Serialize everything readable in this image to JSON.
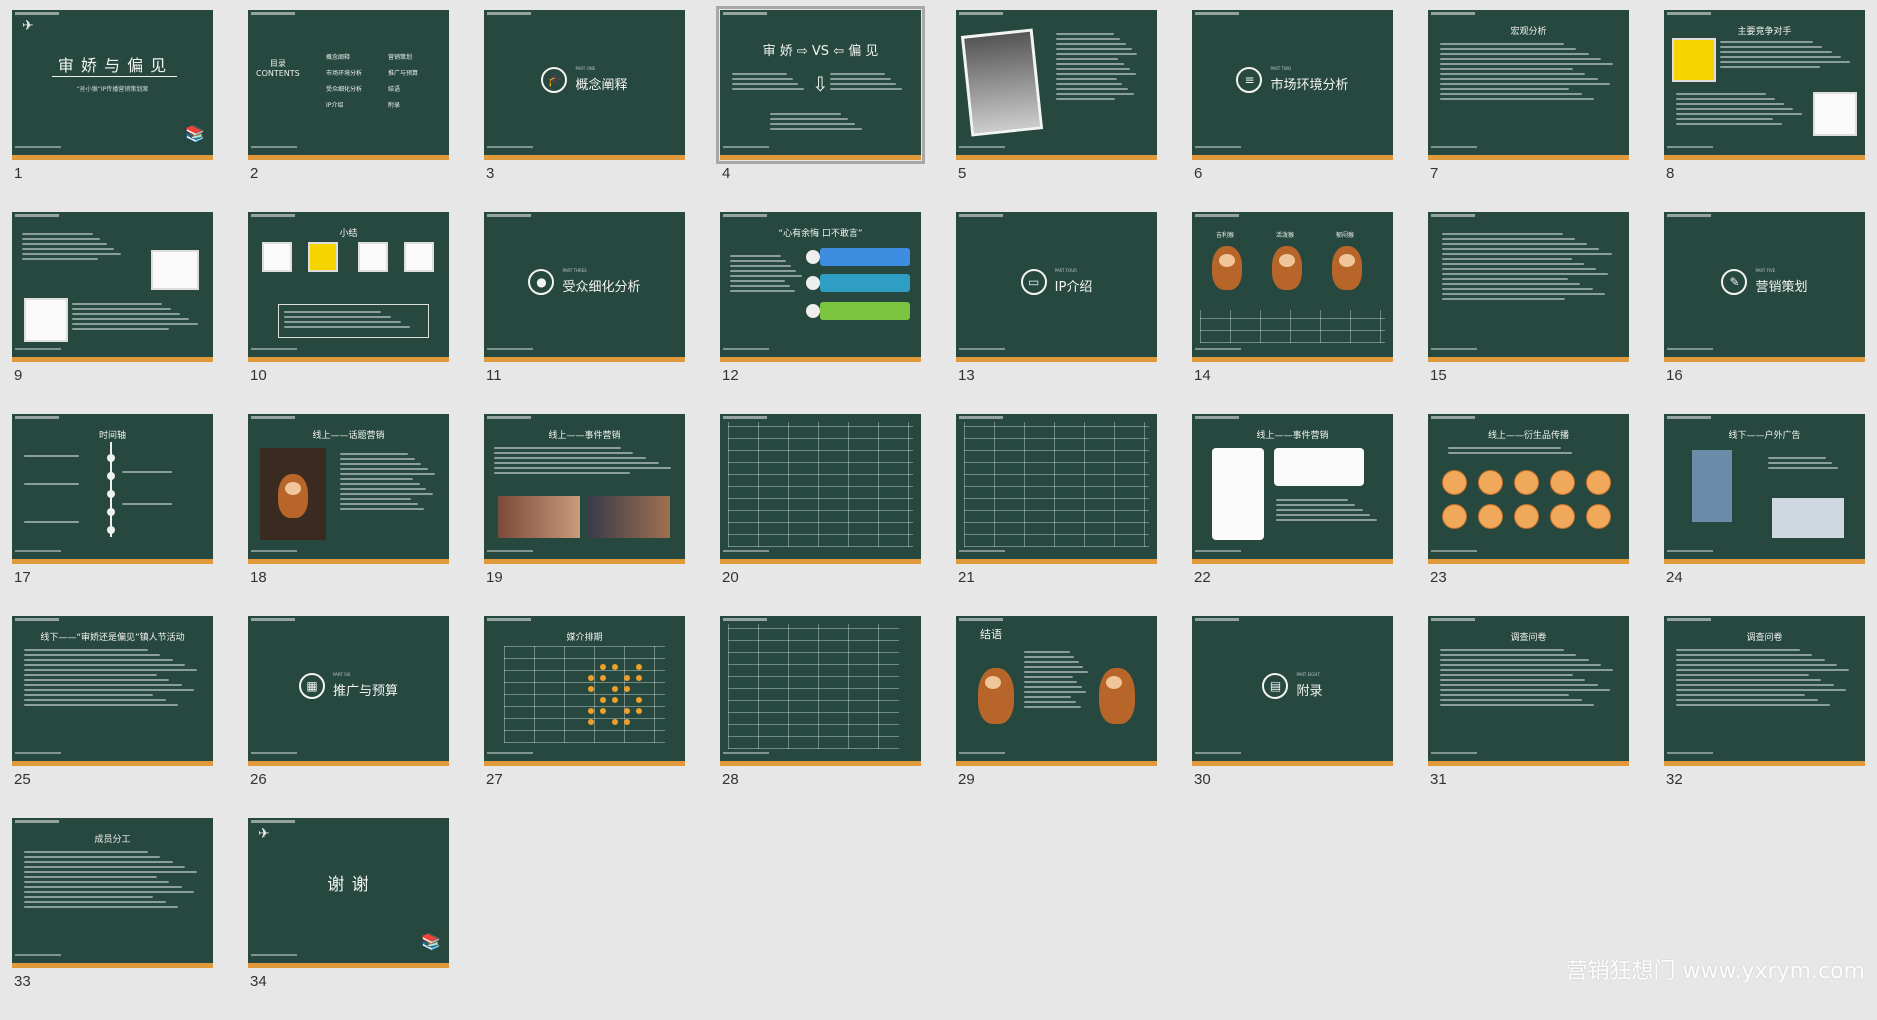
{
  "watermark": "营销狂想门 www.yxrym.com",
  "colors": {
    "slide_bg": "#26483f",
    "slide_border": "#e09a3b",
    "page_bg": "#e7e7e7"
  },
  "selected_slide": 4,
  "slides": [
    {
      "num": "1",
      "kind": "title",
      "title": "审 娇 与 偏 见",
      "subtitle": "“孙小猴”IP传播营销策划案"
    },
    {
      "num": "2",
      "kind": "contents",
      "title": "目录\nCONTENTS",
      "items": [
        "概念阐释",
        "市场环境分析",
        "受众细化分析",
        "IP介绍",
        "营销策划",
        "推广与预算",
        "结语",
        "附录"
      ]
    },
    {
      "num": "3",
      "kind": "section",
      "icon": "graduation-cap-icon",
      "part": "PART ONE",
      "title": "概念阐释"
    },
    {
      "num": "4",
      "kind": "vs",
      "title": "审 娇 ⇨ VS ⇦ 偏 见"
    },
    {
      "num": "5",
      "kind": "portrait"
    },
    {
      "num": "6",
      "kind": "section",
      "icon": "stack-icon",
      "part": "PART TWO",
      "title": "市场环境分析"
    },
    {
      "num": "7",
      "kind": "text",
      "title": "宏观分析"
    },
    {
      "num": "8",
      "kind": "competitor",
      "title": "主要竞争对手"
    },
    {
      "num": "9",
      "kind": "bullets-pic"
    },
    {
      "num": "10",
      "kind": "summary",
      "title": "小结"
    },
    {
      "num": "11",
      "kind": "section",
      "icon": "apple-icon",
      "part": "PART THREE",
      "title": "受众细化分析"
    },
    {
      "num": "12",
      "kind": "bubbles",
      "title": "“心有余悔 口不敢言”"
    },
    {
      "num": "13",
      "kind": "section",
      "icon": "book-icon",
      "part": "PART FOUR",
      "title": "IP介绍"
    },
    {
      "num": "14",
      "kind": "monkeys3",
      "labels": [
        "吉利猴",
        "活泼猴",
        "郁闷猴"
      ]
    },
    {
      "num": "15",
      "kind": "bullets"
    },
    {
      "num": "16",
      "kind": "section",
      "icon": "pen-icon",
      "part": "PART FIVE",
      "title": "营销策划"
    },
    {
      "num": "17",
      "kind": "timeline",
      "title": "时间轴"
    },
    {
      "num": "18",
      "kind": "topic",
      "title": "线上——话题营销"
    },
    {
      "num": "19",
      "kind": "event",
      "title": "线上——事件营销"
    },
    {
      "num": "20",
      "kind": "table"
    },
    {
      "num": "21",
      "kind": "table"
    },
    {
      "num": "22",
      "kind": "chat",
      "title": "线上——事件营销"
    },
    {
      "num": "23",
      "kind": "faces",
      "title": "线上——衍生品传播"
    },
    {
      "num": "24",
      "kind": "outdoor",
      "title": "线下——户外广告"
    },
    {
      "num": "25",
      "kind": "text",
      "title": "线下——“审娇还是偏见”镇人节活动"
    },
    {
      "num": "26",
      "kind": "section",
      "icon": "calendar-icon",
      "part": "PART SIX",
      "title": "推广与预算"
    },
    {
      "num": "27",
      "kind": "schedule",
      "title": "媒介排期"
    },
    {
      "num": "28",
      "kind": "budget"
    },
    {
      "num": "29",
      "kind": "ending",
      "title": "结语"
    },
    {
      "num": "30",
      "kind": "section",
      "icon": "document-icon",
      "part": "PART EIGHT",
      "title": "附录"
    },
    {
      "num": "31",
      "kind": "text",
      "title": "调查问卷"
    },
    {
      "num": "32",
      "kind": "text",
      "title": "调查问卷"
    },
    {
      "num": "33",
      "kind": "text",
      "title": "成员分工"
    },
    {
      "num": "34",
      "kind": "thanks",
      "title": "谢 谢"
    }
  ]
}
